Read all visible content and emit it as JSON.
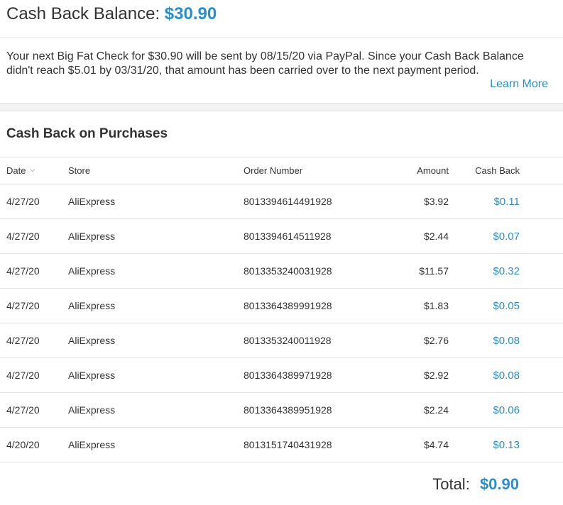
{
  "balance": {
    "label": "Cash Back Balance:",
    "amount": "$30.90"
  },
  "notice": {
    "text": "Your next Big Fat Check for $30.90 will be sent by 08/15/20 via PayPal. Since your Cash Back Balance didn't reach $5.01 by 03/31/20, that amount has been carried over to the next payment period.",
    "link": "Learn More"
  },
  "section": {
    "title": "Cash Back on Purchases"
  },
  "table": {
    "columns": {
      "date": "Date",
      "store": "Store",
      "order": "Order Number",
      "amount": "Amount",
      "cashback": "Cash Back"
    },
    "sort_icon": "chevron-down-icon",
    "rows": [
      {
        "date": "4/27/20",
        "store": "AliExpress",
        "order": "8013394614491928",
        "amount": "$3.92",
        "cashback": "$0.11"
      },
      {
        "date": "4/27/20",
        "store": "AliExpress",
        "order": "8013394614511928",
        "amount": "$2.44",
        "cashback": "$0.07"
      },
      {
        "date": "4/27/20",
        "store": "AliExpress",
        "order": "8013353240031928",
        "amount": "$11.57",
        "cashback": "$0.32"
      },
      {
        "date": "4/27/20",
        "store": "AliExpress",
        "order": "8013364389991928",
        "amount": "$1.83",
        "cashback": "$0.05"
      },
      {
        "date": "4/27/20",
        "store": "AliExpress",
        "order": "8013353240011928",
        "amount": "$2.76",
        "cashback": "$0.08"
      },
      {
        "date": "4/27/20",
        "store": "AliExpress",
        "order": "8013364389971928",
        "amount": "$2.92",
        "cashback": "$0.08"
      },
      {
        "date": "4/27/20",
        "store": "AliExpress",
        "order": "8013364389951928",
        "amount": "$2.24",
        "cashback": "$0.06"
      },
      {
        "date": "4/20/20",
        "store": "AliExpress",
        "order": "8013151740431928",
        "amount": "$4.74",
        "cashback": "$0.13"
      }
    ]
  },
  "total": {
    "label": "Total:",
    "value": "$0.90"
  },
  "colors": {
    "accent": "#2a8dd2",
    "text": "#333333",
    "divider": "#e2e2e2",
    "band": "#f2f2f2"
  }
}
